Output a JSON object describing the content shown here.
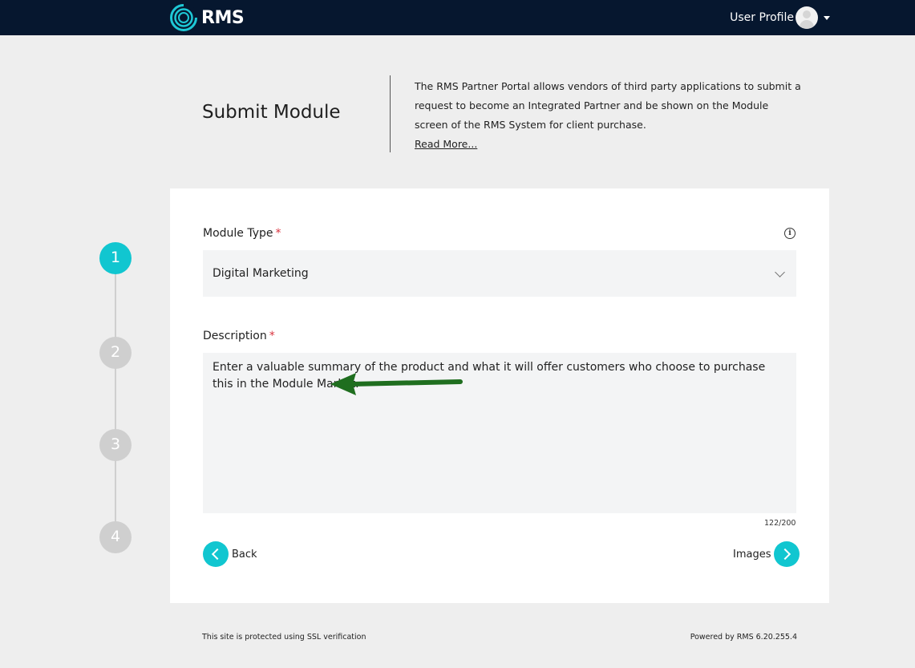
{
  "header": {
    "logo_text": "RMS",
    "user_profile_label": "User Profile",
    "bar_color": "#06172f"
  },
  "page": {
    "title": "Submit Module",
    "intro": "The RMS Partner Portal allows vendors of third party applications to submit a request to become an Integrated Partner and be shown on the Module screen of the RMS System for client purchase.",
    "read_more": "Read More..."
  },
  "stepper": {
    "steps": [
      "1",
      "2",
      "3",
      "4"
    ],
    "active_step": "1",
    "active_color": "#11c6d0"
  },
  "form": {
    "module_type_label": "Module Type",
    "required_mark": "*",
    "module_type_value": "Digital Marketing",
    "description_label": "Description",
    "description_value": "Enter a valuable summary of the product and what it will offer customers who choose to purchase this in the Module Market.",
    "char_counter": "122/200",
    "back_label": "Back",
    "next_label": "Images"
  },
  "annotation": {
    "arrow_color": "#1f6e1f"
  },
  "footer": {
    "ssl_note": "This site is protected using SSL verification",
    "powered_by": "Powered by RMS 6.20.255.4"
  }
}
